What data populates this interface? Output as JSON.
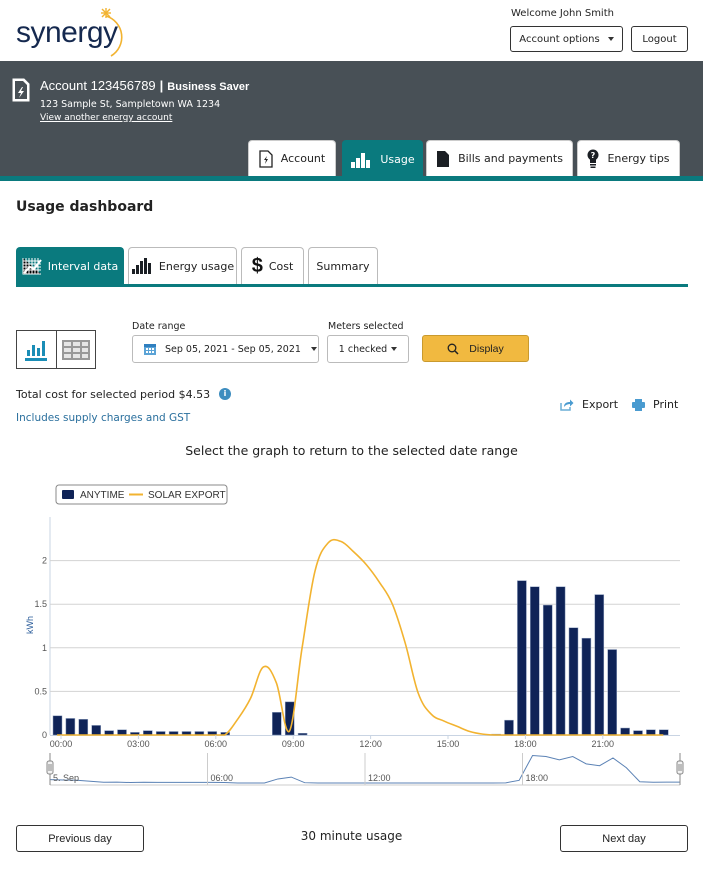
{
  "brand": {
    "name": "synergy",
    "accent": "#0a7a7e",
    "sun": "#f2b330",
    "navy": "#15294f"
  },
  "header": {
    "welcome": "Welcome John Smith",
    "account_options": "Account options",
    "logout": "Logout"
  },
  "account": {
    "title": "Account 123456789",
    "separator": "|",
    "plan": "Business Saver",
    "address": "123 Sample St, Sampletown WA 1234",
    "switch_link": "View another energy account"
  },
  "main_tabs": [
    {
      "label": "Account",
      "icon": "document-bolt-icon",
      "active": false
    },
    {
      "label": "Usage",
      "icon": "bar-chart-icon",
      "active": true
    },
    {
      "label": "Bills and payments",
      "icon": "document-icon",
      "active": false
    },
    {
      "label": "Energy tips",
      "icon": "lightbulb-icon",
      "active": false
    }
  ],
  "page_title": "Usage dashboard",
  "sub_tabs": [
    {
      "label": "Interval data",
      "icon": "grid-chart-icon",
      "active": true
    },
    {
      "label": "Energy usage",
      "icon": "bar-chart-icon",
      "active": false
    },
    {
      "label": "Cost",
      "icon": "dollar-icon",
      "active": false
    },
    {
      "label": "Summary",
      "icon": "",
      "active": false
    }
  ],
  "filters": {
    "date_range_label": "Date range",
    "date_range_value": "Sep 05, 2021 - Sep 05, 2021",
    "meters_label": "Meters selected",
    "meters_value": "1 checked",
    "display_button": "Display"
  },
  "view_toggle": {
    "chart_selected": true
  },
  "summary": {
    "total_cost": "Total cost for selected period $4.53",
    "info_icon": "i",
    "includes": "Includes supply charges and GST",
    "export": "Export",
    "print": "Print"
  },
  "chart_heading": "Select the graph to return to the selected date range",
  "chart_data": {
    "type": "bar",
    "title": "",
    "xlabel": "",
    "ylabel": "kWh",
    "ylim": [
      0,
      2.5
    ],
    "yticks": [
      "0",
      "0.5",
      "1",
      "1.5",
      "2"
    ],
    "ytick_values": [
      0,
      0.5,
      1,
      1.5,
      2
    ],
    "xtick_labels": [
      "00:00",
      "03:00",
      "06:00",
      "09:00",
      "12:00",
      "15:00",
      "18:00",
      "21:00"
    ],
    "interval_minutes": 30,
    "grid": true,
    "legend_position": "top-left",
    "x": [
      "00:00",
      "00:30",
      "01:00",
      "01:30",
      "02:00",
      "02:30",
      "03:00",
      "03:30",
      "04:00",
      "04:30",
      "05:00",
      "05:30",
      "06:00",
      "06:30",
      "07:00",
      "07:30",
      "08:00",
      "08:30",
      "09:00",
      "09:30",
      "10:00",
      "10:30",
      "11:00",
      "11:30",
      "12:00",
      "12:30",
      "13:00",
      "13:30",
      "14:00",
      "14:30",
      "15:00",
      "15:30",
      "16:00",
      "16:30",
      "17:00",
      "17:30",
      "18:00",
      "18:30",
      "19:00",
      "19:30",
      "20:00",
      "20:30",
      "21:00",
      "21:30",
      "22:00",
      "22:30",
      "23:00",
      "23:30"
    ],
    "series": [
      {
        "name": "ANYTIME",
        "type": "bar",
        "color": "#0f2357",
        "values": [
          0.22,
          0.19,
          0.18,
          0.11,
          0.05,
          0.06,
          0.03,
          0.05,
          0.04,
          0.04,
          0.04,
          0.04,
          0.04,
          0.03,
          0,
          0,
          0,
          0.26,
          0.38,
          0.02,
          0,
          0,
          0,
          0,
          0,
          0,
          0,
          0,
          0,
          0,
          0,
          0,
          0,
          0,
          0.01,
          0.17,
          1.77,
          1.7,
          1.49,
          1.7,
          1.23,
          1.11,
          1.61,
          0.98,
          0.08,
          0.05,
          0.06,
          0.06
        ]
      },
      {
        "name": "SOLAR EXPORT",
        "type": "line",
        "color": "#f2b330",
        "values": [
          0,
          0,
          0,
          0,
          0,
          0,
          0,
          0,
          0,
          0,
          0,
          0,
          0,
          0,
          0.18,
          0.42,
          0.78,
          0.6,
          0.04,
          1.0,
          1.88,
          2.2,
          2.22,
          2.1,
          1.95,
          1.75,
          1.5,
          1.05,
          0.48,
          0.24,
          0.16,
          0.1,
          0.04,
          0.01,
          0,
          0,
          0,
          0,
          0,
          0,
          0,
          0,
          0,
          0,
          0,
          0,
          0,
          0
        ]
      }
    ],
    "navigator": {
      "labels": [
        "5. Sep",
        "06:00",
        "12:00",
        "18:00"
      ]
    }
  },
  "footer": {
    "previous": "Previous day",
    "interval": "30 minute usage",
    "next": "Next day"
  }
}
